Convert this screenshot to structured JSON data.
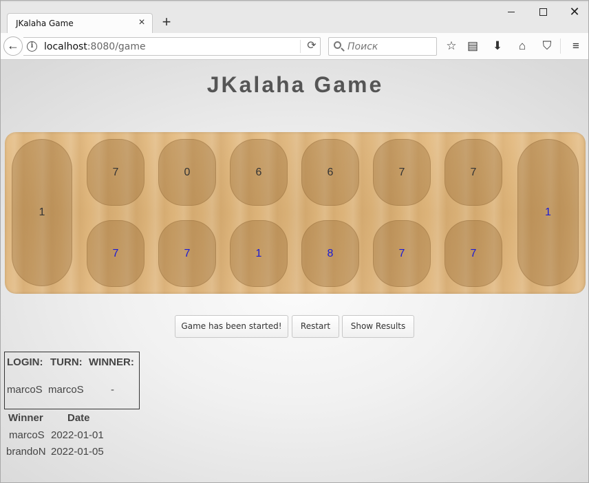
{
  "browser": {
    "tab_title": "JKalaha Game",
    "tab_close": "×",
    "new_tab": "+",
    "url_host": "localhost",
    "url_rest": ":8080/game",
    "search_placeholder": "Поиск",
    "icons": [
      "back-arrow-icon",
      "info-icon",
      "reload-icon",
      "search-icon",
      "star-icon",
      "reading-list-icon",
      "download-icon",
      "home-icon",
      "pocket-icon",
      "menu-icon"
    ]
  },
  "page": {
    "title": "JKalaha Game"
  },
  "board": {
    "left_store": "1",
    "right_store": "1",
    "top_pits": [
      "7",
      "0",
      "6",
      "6",
      "7",
      "7"
    ],
    "bottom_pits": [
      "7",
      "7",
      "1",
      "8",
      "7",
      "7"
    ],
    "colors": {
      "top_text": "#333333",
      "bottom_text": "#1a1ad6"
    }
  },
  "buttons": {
    "status": "Game has been started!",
    "restart": "Restart",
    "show_results": "Show Results"
  },
  "status": {
    "headers": {
      "login": "LOGIN:",
      "turn": "TURN:",
      "winner": "WINNER:"
    },
    "values": {
      "login": "marcoS",
      "turn": "marcoS",
      "winner": "-"
    }
  },
  "results": {
    "headers": {
      "winner": "Winner",
      "date": "Date"
    },
    "rows": [
      {
        "winner": "marcoS",
        "date": "2022-01-01"
      },
      {
        "winner": "brandoN",
        "date": "2022-01-05"
      }
    ]
  }
}
